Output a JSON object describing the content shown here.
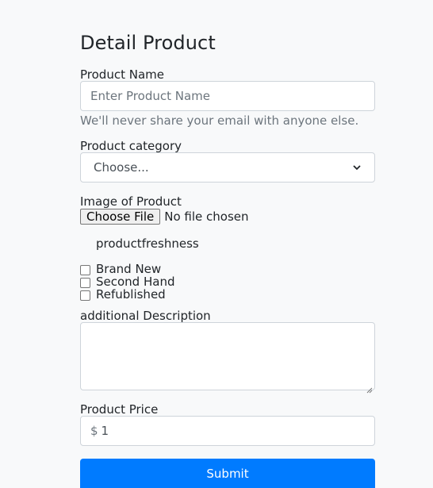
{
  "page": {
    "title": "Detail Product"
  },
  "product_name": {
    "label": "Product Name",
    "placeholder": "Enter Product Name",
    "help": "We'll never share your email with anyone else."
  },
  "category": {
    "label": "Product category",
    "selected": "Choose..."
  },
  "image": {
    "label": "Image of Product",
    "button_label": "Choose File",
    "status": "No file chosen"
  },
  "freshness": {
    "label": "productfreshness",
    "options": [
      {
        "label": "Brand New"
      },
      {
        "label": "Second Hand"
      },
      {
        "label": "Refublished"
      }
    ]
  },
  "description": {
    "label": "additional Description"
  },
  "price": {
    "label": "Product Price",
    "currency": "$",
    "value": "1"
  },
  "submit": {
    "label": "Submit"
  },
  "colors": {
    "primary": "#007bff",
    "background": "#f8f9fa",
    "border": "#ced4da",
    "muted": "#6c757d"
  },
  "icons": {
    "select_arrow": "chevron-down-icon",
    "textarea_resize": "resize-handle-icon"
  }
}
